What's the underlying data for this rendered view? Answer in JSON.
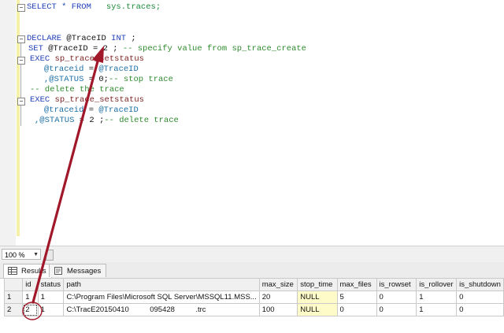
{
  "editor": {
    "lines": {
      "l1": {
        "kw": "SELECT * FROM",
        "obj": "sys.traces;"
      },
      "l2": {
        "kw": "DECLARE",
        "var": "@TraceID",
        "type": "INT",
        "end": ";"
      },
      "l3": {
        "kw": "SET",
        "var": "@TraceID",
        "op": "=",
        "num": "2",
        "rest": ";",
        "comment": "-- specify value from sp_trace_create"
      },
      "l4": {
        "kw": "EXEC",
        "proc": "sp_trace_setstatus"
      },
      "l5": {
        "var": "@traceid",
        "op": "=",
        "val": "@TraceID"
      },
      "l6": {
        "var": ",@STATUS",
        "op": "=",
        "num": "0",
        "rest": ";",
        "comment": "-- stop trace"
      },
      "l7": {
        "comment": "-- delete the trace"
      },
      "l8": {
        "kw": "EXEC",
        "proc": "sp_trace_setstatus"
      },
      "l9": {
        "var": "@traceid",
        "op": "=",
        "val": "@TraceID"
      },
      "l10": {
        "var": ",@STATUS",
        "op": "=",
        "num": "2",
        "rest": ";",
        "comment": "-- delete trace"
      }
    }
  },
  "zoom": {
    "value": "100 %"
  },
  "tabs": {
    "results": "Results",
    "messages": "Messages"
  },
  "grid": {
    "columns": [
      "id",
      "status",
      "path",
      "max_size",
      "stop_time",
      "max_files",
      "is_rowset",
      "is_rollover",
      "is_shutdown"
    ],
    "rows": [
      {
        "rownum": "1",
        "id": "1",
        "status": "1",
        "path": "C:\\Program Files\\Microsoft SQL Server\\MSSQL11.MSS...",
        "max_size": "20",
        "stop_time": "NULL",
        "max_files": "5",
        "is_rowset": "0",
        "is_rollover": "1",
        "is_shutdown": "0"
      },
      {
        "rownum": "2",
        "id": "2",
        "status": "1",
        "path": "C:\\TracE20150410          095428          .trc",
        "max_size": "100",
        "stop_time": "NULL",
        "max_files": "0",
        "is_rowset": "0",
        "is_rollover": "1",
        "is_shutdown": "0"
      }
    ]
  },
  "colors": {
    "annotation": "#a0182a",
    "null_bg": "#fffbc8",
    "keyword": "#1f3fb8",
    "comment": "#2f8a2f"
  }
}
